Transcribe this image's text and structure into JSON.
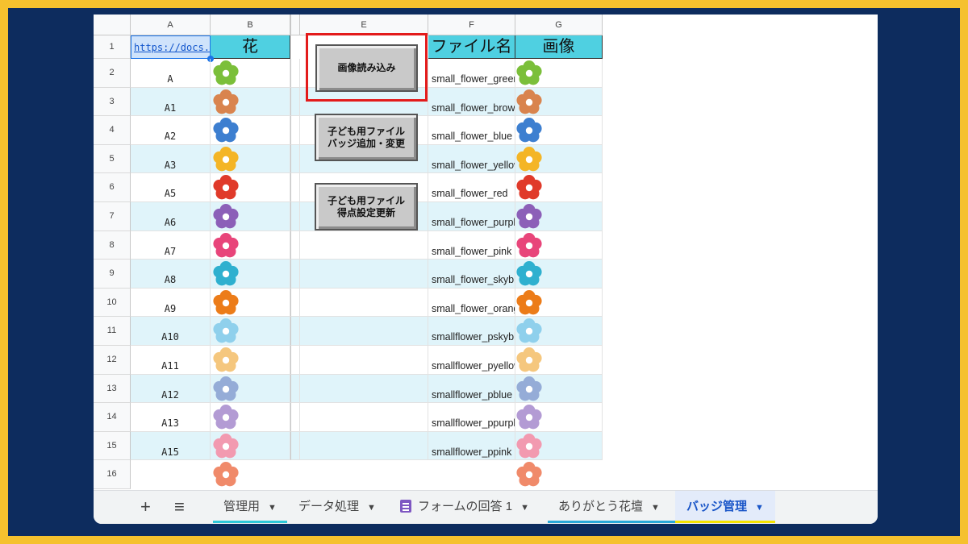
{
  "columns": [
    "A",
    "B",
    "E",
    "F",
    "G"
  ],
  "rows": [
    "1",
    "2",
    "3",
    "4",
    "5",
    "6",
    "7",
    "8",
    "9",
    "10",
    "11",
    "12",
    "13",
    "14",
    "15",
    "16"
  ],
  "header_row": {
    "a": "https://docs.google.com",
    "b": "花",
    "f": "ファイル名",
    "g": "画像"
  },
  "a_values": [
    "A",
    "A1",
    "A2",
    "A3",
    "A5",
    "A6",
    "A7",
    "A8",
    "A9",
    "A10",
    "A11",
    "A12",
    "A13",
    "A15"
  ],
  "f_values": [
    "small_flower_green",
    "small_flower_brown",
    "small_flower_blue",
    "small_flower_yellow",
    "small_flower_red",
    "small_flower_purple",
    "small_flower_pink",
    "small_flower_skyblue",
    "small_flower_orange",
    "smallflower_pskyblue",
    "smallflower_pyellow",
    "smallflower_pblue",
    "smallflower_ppurple",
    "smallflower_ppink"
  ],
  "flower_colors": [
    "#7bbf3a",
    "#d9844e",
    "#3d7fd0",
    "#f4b526",
    "#e03a2a",
    "#8c5fb8",
    "#e8457a",
    "#2fb0cf",
    "#ec7c19",
    "#8fd0ec",
    "#f5c77e",
    "#95acd7",
    "#b39bd4",
    "#f29ab0",
    "#f08a6a"
  ],
  "buttons": {
    "load_images": "画像読み込み",
    "badge_line1": "子ども用ファイル",
    "badge_line2": "バッジ追加・変更",
    "score_line1": "子ども用ファイル",
    "score_line2": "得点設定更新"
  },
  "tabs": {
    "add": "+",
    "menu": "≡",
    "t1": "管理用",
    "t2": "データ処理",
    "t3": "フォームの回答 1",
    "t4": "ありがとう花壇",
    "t5": "バッジ管理"
  },
  "colors": {
    "accent": "#e31b1b",
    "header_cyan": "#4fd0e1",
    "row_cyan": "#e0f4fa",
    "frame": "#0d2c5e",
    "border": "#f5c12e"
  }
}
